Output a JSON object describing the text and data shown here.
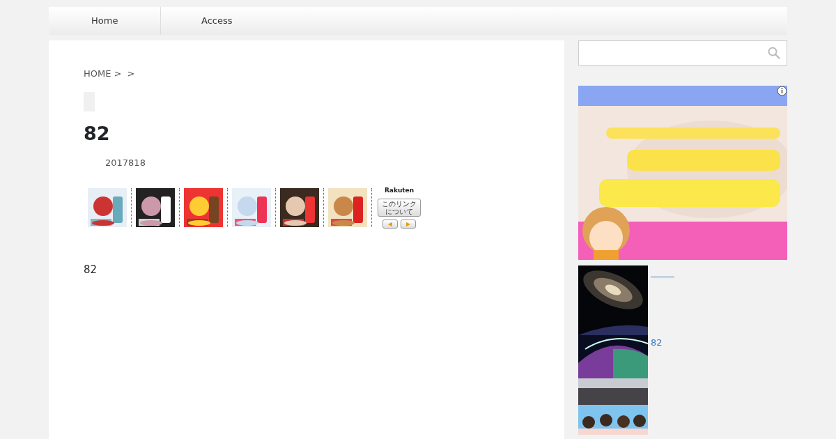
{
  "nav": [
    {
      "label": "Home"
    },
    {
      "label": "Access"
    }
  ],
  "breadcrumb": {
    "home": "HOME >",
    "sep": ">"
  },
  "article": {
    "title": "82",
    "date": "2017818",
    "body": "82"
  },
  "rakuten_widget": {
    "logo": "Rakuten",
    "about_button": "このリンクについて",
    "prev": "◀",
    "next": "▶"
  },
  "sidebar": {
    "post": {
      "title": "82"
    }
  }
}
